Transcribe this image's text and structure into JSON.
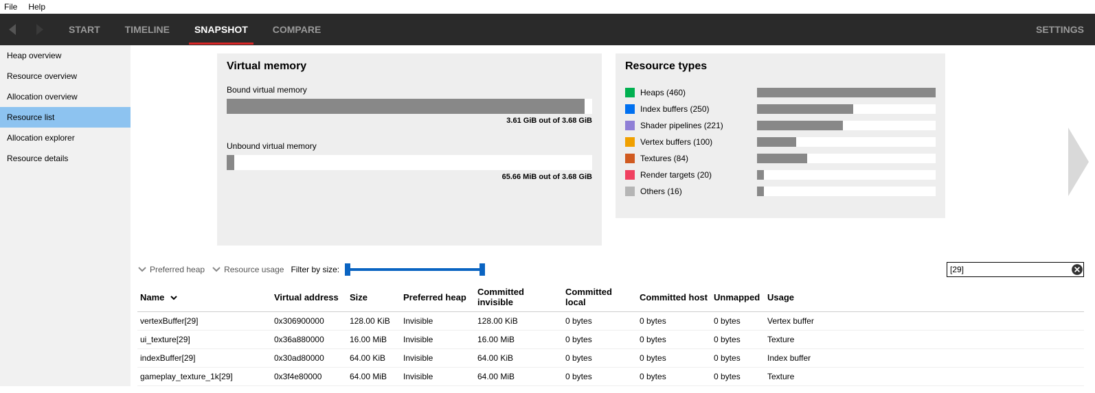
{
  "menubar": {
    "file": "File",
    "help": "Help"
  },
  "tabs": {
    "start": "START",
    "timeline": "TIMELINE",
    "snapshot": "SNAPSHOT",
    "compare": "COMPARE",
    "settings": "SETTINGS"
  },
  "sidebar": {
    "items": [
      {
        "label": "Heap overview"
      },
      {
        "label": "Resource overview"
      },
      {
        "label": "Allocation overview"
      },
      {
        "label": "Resource list",
        "selected": true
      },
      {
        "label": "Allocation explorer"
      },
      {
        "label": "Resource details"
      }
    ]
  },
  "vm_panel": {
    "title": "Virtual memory",
    "bound_label": "Bound virtual memory",
    "bound_stat": "3.61 GiB out of 3.68 GiB",
    "bound_pct": 98,
    "unbound_label": "Unbound virtual memory",
    "unbound_stat": "65.66 MiB out of 3.68 GiB",
    "unbound_pct": 2
  },
  "rt_panel": {
    "title": "Resource types",
    "rows": [
      {
        "color": "#00b050",
        "label": "Heaps (460)",
        "pct": 100
      },
      {
        "color": "#0070f0",
        "label": "Index buffers (250)",
        "pct": 54
      },
      {
        "color": "#8f7fd6",
        "label": "Shader pipelines (221)",
        "pct": 48
      },
      {
        "color": "#f0a000",
        "label": "Vertex buffers (100)",
        "pct": 22
      },
      {
        "color": "#d05a20",
        "label": "Textures (84)",
        "pct": 28
      },
      {
        "color": "#f04060",
        "label": "Render targets (20)",
        "pct": 4
      },
      {
        "color": "#b5b5b5",
        "label": "Others (16)",
        "pct": 4
      }
    ]
  },
  "filters": {
    "preferred_heap": "Preferred heap",
    "resource_usage": "Resource usage",
    "filter_by_size": "Filter by size:",
    "search_value": "[29]"
  },
  "table": {
    "headers": {
      "name": "Name",
      "addr": "Virtual address",
      "size": "Size",
      "pheap": "Preferred heap",
      "cinv": "Committed invisible",
      "cloc": "Committed local",
      "chost": "Committed host",
      "unmap": "Unmapped",
      "usage": "Usage"
    },
    "rows": [
      {
        "name": "vertexBuffer[29]",
        "addr": "0x306900000",
        "size": "128.00 KiB",
        "pheap": "Invisible",
        "cinv": "128.00 KiB",
        "cloc": "0 bytes",
        "chost": "0 bytes",
        "unmap": "0 bytes",
        "usage": "Vertex buffer"
      },
      {
        "name": "ui_texture[29]",
        "addr": "0x36a880000",
        "size": "16.00 MiB",
        "pheap": "Invisible",
        "cinv": "16.00 MiB",
        "cloc": "0 bytes",
        "chost": "0 bytes",
        "unmap": "0 bytes",
        "usage": "Texture"
      },
      {
        "name": "indexBuffer[29]",
        "addr": "0x30ad80000",
        "size": "64.00 KiB",
        "pheap": "Invisible",
        "cinv": "64.00 KiB",
        "cloc": "0 bytes",
        "chost": "0 bytes",
        "unmap": "0 bytes",
        "usage": "Index buffer"
      },
      {
        "name": "gameplay_texture_1k[29]",
        "addr": "0x3f4e80000",
        "size": "64.00 MiB",
        "pheap": "Invisible",
        "cinv": "64.00 MiB",
        "cloc": "0 bytes",
        "chost": "0 bytes",
        "unmap": "0 bytes",
        "usage": "Texture"
      }
    ]
  }
}
